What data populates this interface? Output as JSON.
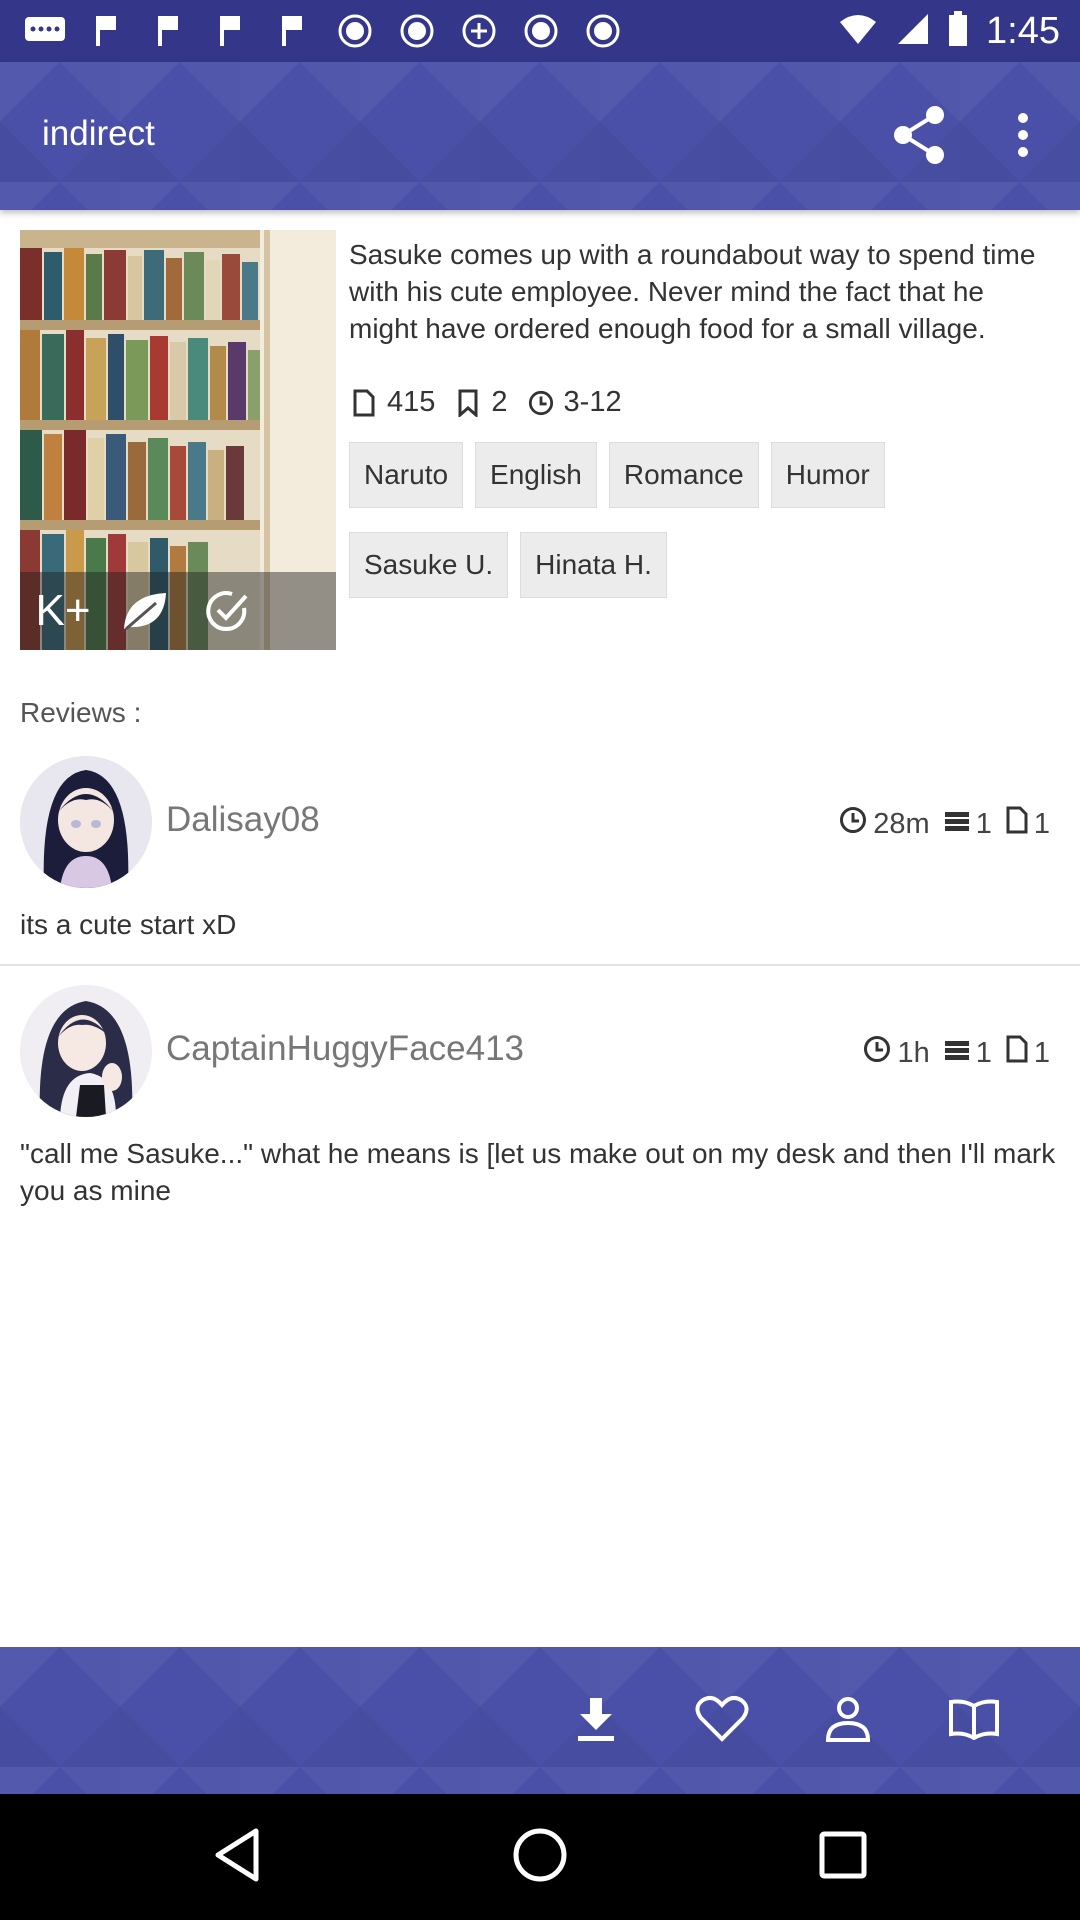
{
  "status_bar": {
    "time": "1:45",
    "notification_icons": [
      "chat-icon",
      "flag-icon",
      "flag-icon",
      "flag-icon",
      "flag-icon",
      "abc-news-icon",
      "abc-news-icon",
      "abc7-icon",
      "abc-news-icon",
      "abc-news-icon"
    ]
  },
  "app_bar": {
    "title": "indirect",
    "share_icon": "share-icon",
    "more_icon": "more-vert-icon"
  },
  "story": {
    "summary": "Sasuke comes up with a roundabout way to spend time with his cute employee. Never mind the fact that he might have ordered enough food for a small village.",
    "words": "415",
    "chapters": "2",
    "updated": "3-12",
    "cover_badges": [
      "K+",
      "leaf-icon",
      "check-complete-icon"
    ],
    "badge_rating": "K+",
    "tags_row1": [
      "Naruto",
      "English",
      "Romance",
      "Humor"
    ],
    "tags_row2": [
      "Sasuke U.",
      "Hinata H."
    ]
  },
  "reviews_label": "Reviews :",
  "reviews": [
    {
      "user": "Dalisay08",
      "time": "28m",
      "reviews_count": "1",
      "chapter": "1",
      "text": "its a cute start xD"
    },
    {
      "user": "CaptainHuggyFace413",
      "time": "1h",
      "reviews_count": "1",
      "chapter": "1",
      "text": "\"call me Sasuke...\" what he means is [let us make out on my desk and then I'll mark you as mine"
    }
  ],
  "bottom_bar": [
    "download-icon",
    "favorite-heart-icon",
    "follow-person-icon",
    "read-book-icon"
  ],
  "nav_bar": [
    "back-icon",
    "home-icon",
    "recents-icon"
  ],
  "colors": {
    "primary": "#4a50a8",
    "status_bar": "#34368a",
    "tag_background": "#ececec"
  }
}
